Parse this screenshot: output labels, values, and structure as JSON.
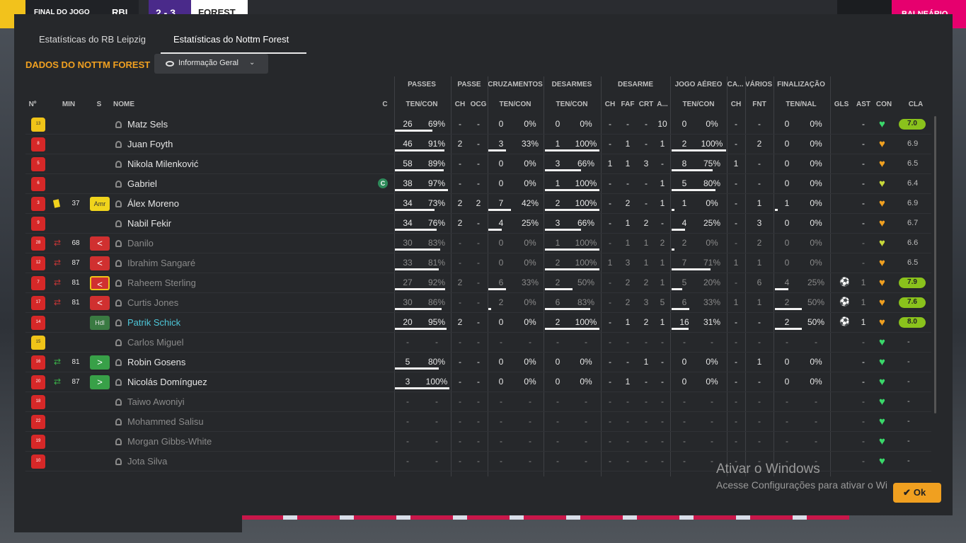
{
  "scoreboard": {
    "result_label": "FINAL DO JOGO",
    "home_short": "RBL",
    "score": "2 - 3",
    "away_short": "FOREST",
    "right_label": "BALNEÁRIO"
  },
  "tabs": [
    {
      "label": "Estatísticas do RB Leipzig",
      "active": false
    },
    {
      "label": "Estatísticas do Nottm Forest",
      "active": true
    }
  ],
  "section_title": "DADOS DO NOTTM FOREST",
  "view_dropdown": {
    "label": "Informação Geral"
  },
  "group_headers": [
    "PASSES",
    "PASSE",
    "CRUZAMENTOS",
    "DESARMES",
    "DESARME",
    "JOGO AÉREO",
    "CA...",
    "VÁRIOS",
    "FINALIZAÇÃO"
  ],
  "column_headers": [
    "Nº",
    "MIN",
    "S",
    "NOME",
    "C",
    "TEN/CON",
    "CH",
    "OCG",
    "TEN/CON",
    "TEN/CON",
    "CH",
    "FAF",
    "CRT",
    "A...",
    "TEN/CON",
    "CH",
    "FNT",
    "TEN/NAL",
    "GLS",
    "AST",
    "CON",
    "CLA"
  ],
  "players": [
    {
      "no": "13",
      "kit": "gk",
      "card": false,
      "sub": "",
      "min": "",
      "pos": "",
      "pos_style": "",
      "name": "Matz Sels",
      "name_style": "",
      "captain": false,
      "dim": false,
      "pass_a": "26",
      "pass_p": "69%",
      "pass_bar": 0.69,
      "ch": "-",
      "ocg": "-",
      "cr_a": "0",
      "cr_p": "0%",
      "cr_bar": 0,
      "des_a": "0",
      "des_p": "0%",
      "des_bar": 0,
      "d_ch": "-",
      "faf": "-",
      "crt": "-",
      "a": "10",
      "air_a": "0",
      "air_p": "0%",
      "air_bar": 0,
      "ca": "-",
      "fnt": "-",
      "fin_a": "0",
      "fin_p": "0%",
      "fin_bar": 0,
      "gls": "",
      "ast": "-",
      "con": "green",
      "cla": "7.0",
      "cla_badge": true
    },
    {
      "no": "8",
      "kit": "",
      "card": false,
      "sub": "",
      "min": "",
      "pos": "",
      "pos_style": "",
      "name": "Juan Foyth",
      "name_style": "",
      "captain": false,
      "dim": false,
      "pass_a": "46",
      "pass_p": "91%",
      "pass_bar": 0.91,
      "ch": "2",
      "ocg": "-",
      "cr_a": "3",
      "cr_p": "33%",
      "cr_bar": 0.33,
      "des_a": "1",
      "des_p": "100%",
      "des_bar": 1,
      "d_ch": "-",
      "faf": "1",
      "crt": "-",
      "a": "1",
      "air_a": "2",
      "air_p": "100%",
      "air_bar": 1,
      "ca": "-",
      "fnt": "2",
      "fin_a": "0",
      "fin_p": "0%",
      "fin_bar": 0,
      "gls": "",
      "ast": "-",
      "con": "orange",
      "cla": "6.9",
      "cla_badge": false
    },
    {
      "no": "5",
      "kit": "",
      "card": false,
      "sub": "",
      "min": "",
      "pos": "",
      "pos_style": "",
      "name": "Nikola Milenković",
      "name_style": "",
      "captain": false,
      "dim": false,
      "pass_a": "58",
      "pass_p": "89%",
      "pass_bar": 0.89,
      "ch": "-",
      "ocg": "-",
      "cr_a": "0",
      "cr_p": "0%",
      "cr_bar": 0,
      "des_a": "3",
      "des_p": "66%",
      "des_bar": 0.66,
      "d_ch": "1",
      "faf": "1",
      "crt": "3",
      "a": "-",
      "air_a": "8",
      "air_p": "75%",
      "air_bar": 0.75,
      "ca": "1",
      "fnt": "-",
      "fin_a": "0",
      "fin_p": "0%",
      "fin_bar": 0,
      "gls": "",
      "ast": "-",
      "con": "orange",
      "cla": "6.5",
      "cla_badge": false
    },
    {
      "no": "6",
      "kit": "",
      "card": false,
      "sub": "",
      "min": "",
      "pos": "",
      "pos_style": "",
      "name": "Gabriel",
      "name_style": "",
      "captain": true,
      "dim": false,
      "pass_a": "38",
      "pass_p": "97%",
      "pass_bar": 0.97,
      "ch": "-",
      "ocg": "-",
      "cr_a": "0",
      "cr_p": "0%",
      "cr_bar": 0,
      "des_a": "1",
      "des_p": "100%",
      "des_bar": 1,
      "d_ch": "-",
      "faf": "-",
      "crt": "-",
      "a": "1",
      "air_a": "5",
      "air_p": "80%",
      "air_bar": 0.8,
      "ca": "-",
      "fnt": "-",
      "fin_a": "0",
      "fin_p": "0%",
      "fin_bar": 0,
      "gls": "",
      "ast": "-",
      "con": "yellow",
      "cla": "6.4",
      "cla_badge": false
    },
    {
      "no": "3",
      "kit": "",
      "card": true,
      "sub": "",
      "min": "37",
      "pos": "Amr",
      "pos_style": "amr",
      "name": "Álex Moreno",
      "name_style": "",
      "captain": false,
      "dim": false,
      "pass_a": "34",
      "pass_p": "73%",
      "pass_bar": 0.73,
      "ch": "2",
      "ocg": "2",
      "cr_a": "7",
      "cr_p": "42%",
      "cr_bar": 0.42,
      "des_a": "2",
      "des_p": "100%",
      "des_bar": 1,
      "d_ch": "-",
      "faf": "2",
      "crt": "-",
      "a": "1",
      "air_a": "1",
      "air_p": "0%",
      "air_bar": 0,
      "ca": "-",
      "fnt": "1",
      "fin_a": "1",
      "fin_p": "0%",
      "fin_bar": 0,
      "gls": "",
      "ast": "-",
      "con": "orange",
      "cla": "6.9",
      "cla_badge": false
    },
    {
      "no": "9",
      "kit": "",
      "card": false,
      "sub": "",
      "min": "",
      "pos": "",
      "pos_style": "",
      "name": "Nabil Fekir",
      "name_style": "",
      "captain": false,
      "dim": false,
      "pass_a": "34",
      "pass_p": "76%",
      "pass_bar": 0.76,
      "ch": "2",
      "ocg": "-",
      "cr_a": "4",
      "cr_p": "25%",
      "cr_bar": 0.25,
      "des_a": "3",
      "des_p": "66%",
      "des_bar": 0.66,
      "d_ch": "-",
      "faf": "1",
      "crt": "2",
      "a": "-",
      "air_a": "4",
      "air_p": "25%",
      "air_bar": 0.25,
      "ca": "-",
      "fnt": "3",
      "fin_a": "0",
      "fin_p": "0%",
      "fin_bar": 0,
      "gls": "",
      "ast": "-",
      "con": "orange",
      "cla": "6.7",
      "cla_badge": false
    },
    {
      "no": "28",
      "kit": "",
      "card": false,
      "sub": "out",
      "min": "68",
      "pos": "<",
      "pos_style": "out",
      "name": "Danilo",
      "name_style": "",
      "captain": false,
      "dim": true,
      "pass_a": "30",
      "pass_p": "83%",
      "pass_bar": 0.83,
      "ch": "-",
      "ocg": "-",
      "cr_a": "0",
      "cr_p": "0%",
      "cr_bar": 0,
      "des_a": "1",
      "des_p": "100%",
      "des_bar": 1,
      "d_ch": "-",
      "faf": "1",
      "crt": "1",
      "a": "2",
      "air_a": "2",
      "air_p": "0%",
      "air_bar": 0,
      "ca": "-",
      "fnt": "2",
      "fin_a": "0",
      "fin_p": "0%",
      "fin_bar": 0,
      "gls": "",
      "ast": "-",
      "con": "yellow",
      "cla": "6.6",
      "cla_badge": false
    },
    {
      "no": "12",
      "kit": "",
      "card": false,
      "sub": "out",
      "min": "87",
      "pos": "<",
      "pos_style": "out",
      "name": "Ibrahim Sangaré",
      "name_style": "",
      "captain": false,
      "dim": true,
      "pass_a": "33",
      "pass_p": "81%",
      "pass_bar": 0.81,
      "ch": "-",
      "ocg": "-",
      "cr_a": "0",
      "cr_p": "0%",
      "cr_bar": 0,
      "des_a": "2",
      "des_p": "100%",
      "des_bar": 1,
      "d_ch": "1",
      "faf": "3",
      "crt": "1",
      "a": "1",
      "air_a": "7",
      "air_p": "71%",
      "air_bar": 0.71,
      "ca": "1",
      "fnt": "1",
      "fin_a": "0",
      "fin_p": "0%",
      "fin_bar": 0,
      "gls": "",
      "ast": "-",
      "con": "orange",
      "cla": "6.5",
      "cla_badge": false
    },
    {
      "no": "7",
      "kit": "",
      "card": false,
      "sub": "out",
      "min": "81",
      "pos": "<",
      "pos_style": "out outlined",
      "name": "Raheem Sterling",
      "name_style": "",
      "captain": false,
      "dim": true,
      "pass_a": "27",
      "pass_p": "92%",
      "pass_bar": 0.92,
      "ch": "2",
      "ocg": "-",
      "cr_a": "6",
      "cr_p": "33%",
      "cr_bar": 0.33,
      "des_a": "2",
      "des_p": "50%",
      "des_bar": 0.5,
      "d_ch": "-",
      "faf": "2",
      "crt": "2",
      "a": "1",
      "air_a": "5",
      "air_p": "20%",
      "air_bar": 0.2,
      "ca": "-",
      "fnt": "6",
      "fin_a": "4",
      "fin_p": "25%",
      "fin_bar": 0.25,
      "gls": "ball",
      "ast": "1",
      "con": "orange",
      "cla": "7.9",
      "cla_badge": true
    },
    {
      "no": "17",
      "kit": "",
      "card": false,
      "sub": "out",
      "min": "81",
      "pos": "<",
      "pos_style": "out",
      "name": "Curtis Jones",
      "name_style": "",
      "captain": false,
      "dim": true,
      "pass_a": "30",
      "pass_p": "86%",
      "pass_bar": 0.86,
      "ch": "-",
      "ocg": "-",
      "cr_a": "2",
      "cr_p": "0%",
      "cr_bar": 0,
      "des_a": "6",
      "des_p": "83%",
      "des_bar": 0.83,
      "d_ch": "-",
      "faf": "2",
      "crt": "3",
      "a": "5",
      "air_a": "6",
      "air_p": "33%",
      "air_bar": 0.33,
      "ca": "1",
      "fnt": "1",
      "fin_a": "2",
      "fin_p": "50%",
      "fin_bar": 0.5,
      "gls": "ball",
      "ast": "1",
      "con": "orange",
      "cla": "7.6",
      "cla_badge": true
    },
    {
      "no": "14",
      "kit": "",
      "card": false,
      "sub": "",
      "min": "",
      "pos": "Hdl",
      "pos_style": "hdl",
      "name": "Patrik Schick",
      "name_style": "highlight",
      "captain": false,
      "dim": false,
      "pass_a": "20",
      "pass_p": "95%",
      "pass_bar": 0.95,
      "ch": "2",
      "ocg": "-",
      "cr_a": "0",
      "cr_p": "0%",
      "cr_bar": 0,
      "des_a": "2",
      "des_p": "100%",
      "des_bar": 1,
      "d_ch": "-",
      "faf": "1",
      "crt": "2",
      "a": "1",
      "air_a": "16",
      "air_p": "31%",
      "air_bar": 0.31,
      "ca": "-",
      "fnt": "-",
      "fin_a": "2",
      "fin_p": "50%",
      "fin_bar": 0.5,
      "gls": "ball",
      "ast": "1",
      "con": "orange",
      "cla": "8.0",
      "cla_badge": true
    },
    {
      "no": "15",
      "kit": "gk",
      "card": false,
      "sub": "",
      "min": "",
      "pos": "",
      "pos_style": "",
      "name": "Carlos Miguel",
      "name_style": "",
      "captain": false,
      "dim": true,
      "pass_a": "-",
      "pass_p": "-",
      "pass_bar": 0,
      "ch": "-",
      "ocg": "-",
      "cr_a": "-",
      "cr_p": "-",
      "cr_bar": 0,
      "des_a": "-",
      "des_p": "-",
      "des_bar": 0,
      "d_ch": "-",
      "faf": "-",
      "crt": "-",
      "a": "-",
      "air_a": "-",
      "air_p": "-",
      "air_bar": 0,
      "ca": "-",
      "fnt": "-",
      "fin_a": "-",
      "fin_p": "-",
      "fin_bar": 0,
      "gls": "",
      "ast": "-",
      "con": "green",
      "cla": "-",
      "cla_badge": false
    },
    {
      "no": "16",
      "kit": "",
      "card": false,
      "sub": "in",
      "min": "81",
      "pos": ">",
      "pos_style": "in",
      "name": "Robin Gosens",
      "name_style": "",
      "captain": false,
      "dim": false,
      "pass_a": "5",
      "pass_p": "80%",
      "pass_bar": 0.8,
      "ch": "-",
      "ocg": "-",
      "cr_a": "0",
      "cr_p": "0%",
      "cr_bar": 0,
      "des_a": "0",
      "des_p": "0%",
      "des_bar": 0,
      "d_ch": "-",
      "faf": "-",
      "crt": "1",
      "a": "-",
      "air_a": "0",
      "air_p": "0%",
      "air_bar": 0,
      "ca": "-",
      "fnt": "1",
      "fin_a": "0",
      "fin_p": "0%",
      "fin_bar": 0,
      "gls": "",
      "ast": "-",
      "con": "green",
      "cla": "-",
      "cla_badge": false
    },
    {
      "no": "20",
      "kit": "",
      "card": false,
      "sub": "in",
      "min": "87",
      "pos": ">",
      "pos_style": "in",
      "name": "Nicolás Domínguez",
      "name_style": "",
      "captain": false,
      "dim": false,
      "pass_a": "3",
      "pass_p": "100%",
      "pass_bar": 1,
      "ch": "-",
      "ocg": "-",
      "cr_a": "0",
      "cr_p": "0%",
      "cr_bar": 0,
      "des_a": "0",
      "des_p": "0%",
      "des_bar": 0,
      "d_ch": "-",
      "faf": "1",
      "crt": "-",
      "a": "-",
      "air_a": "0",
      "air_p": "0%",
      "air_bar": 0,
      "ca": "-",
      "fnt": "-",
      "fin_a": "0",
      "fin_p": "0%",
      "fin_bar": 0,
      "gls": "",
      "ast": "-",
      "con": "green",
      "cla": "-",
      "cla_badge": false
    },
    {
      "no": "18",
      "kit": "",
      "card": false,
      "sub": "",
      "min": "",
      "pos": "",
      "pos_style": "",
      "name": "Taiwo Awoniyi",
      "name_style": "",
      "captain": false,
      "dim": true,
      "pass_a": "-",
      "pass_p": "-",
      "pass_bar": 0,
      "ch": "-",
      "ocg": "-",
      "cr_a": "-",
      "cr_p": "-",
      "cr_bar": 0,
      "des_a": "-",
      "des_p": "-",
      "des_bar": 0,
      "d_ch": "-",
      "faf": "-",
      "crt": "-",
      "a": "-",
      "air_a": "-",
      "air_p": "-",
      "air_bar": 0,
      "ca": "-",
      "fnt": "-",
      "fin_a": "-",
      "fin_p": "-",
      "fin_bar": 0,
      "gls": "",
      "ast": "-",
      "con": "green",
      "cla": "-",
      "cla_badge": false
    },
    {
      "no": "22",
      "kit": "",
      "card": false,
      "sub": "",
      "min": "",
      "pos": "",
      "pos_style": "",
      "name": "Mohammed Salisu",
      "name_style": "",
      "captain": false,
      "dim": true,
      "pass_a": "-",
      "pass_p": "-",
      "pass_bar": 0,
      "ch": "-",
      "ocg": "-",
      "cr_a": "-",
      "cr_p": "-",
      "cr_bar": 0,
      "des_a": "-",
      "des_p": "-",
      "des_bar": 0,
      "d_ch": "-",
      "faf": "-",
      "crt": "-",
      "a": "-",
      "air_a": "-",
      "air_p": "-",
      "air_bar": 0,
      "ca": "-",
      "fnt": "-",
      "fin_a": "-",
      "fin_p": "-",
      "fin_bar": 0,
      "gls": "",
      "ast": "-",
      "con": "green",
      "cla": "-",
      "cla_badge": false
    },
    {
      "no": "19",
      "kit": "",
      "card": false,
      "sub": "",
      "min": "",
      "pos": "",
      "pos_style": "",
      "name": "Morgan Gibbs-White",
      "name_style": "",
      "captain": false,
      "dim": true,
      "pass_a": "-",
      "pass_p": "-",
      "pass_bar": 0,
      "ch": "-",
      "ocg": "-",
      "cr_a": "-",
      "cr_p": "-",
      "cr_bar": 0,
      "des_a": "-",
      "des_p": "-",
      "des_bar": 0,
      "d_ch": "-",
      "faf": "-",
      "crt": "-",
      "a": "-",
      "air_a": "-",
      "air_p": "-",
      "air_bar": 0,
      "ca": "-",
      "fnt": "-",
      "fin_a": "-",
      "fin_p": "-",
      "fin_bar": 0,
      "gls": "",
      "ast": "-",
      "con": "green",
      "cla": "-",
      "cla_badge": false
    },
    {
      "no": "10",
      "kit": "",
      "card": false,
      "sub": "",
      "min": "",
      "pos": "",
      "pos_style": "",
      "name": "Jota Silva",
      "name_style": "",
      "captain": false,
      "dim": true,
      "pass_a": "-",
      "pass_p": "-",
      "pass_bar": 0,
      "ch": "-",
      "ocg": "-",
      "cr_a": "-",
      "cr_p": "-",
      "cr_bar": 0,
      "des_a": "-",
      "des_p": "-",
      "des_bar": 0,
      "d_ch": "-",
      "faf": "-",
      "crt": "-",
      "a": "-",
      "air_a": "-",
      "air_p": "-",
      "air_bar": 0,
      "ca": "-",
      "fnt": "-",
      "fin_a": "-",
      "fin_p": "-",
      "fin_bar": 0,
      "gls": "",
      "ast": "-",
      "con": "green",
      "cla": "-",
      "cla_badge": false
    }
  ],
  "colors": {
    "accent": "#f0a020",
    "highlight_name": "#4ec6d8",
    "con_green": "#3ad86a",
    "con_orange": "#f0a020",
    "con_yellow": "#c8d83a",
    "rating_badge": "#8ac21c"
  },
  "icons": {
    "captain": "captain-c-icon",
    "goal": "football-icon",
    "sub_out": "substitution-out-icon",
    "sub_in": "substitution-in-icon",
    "condition": "heart-icon"
  },
  "watermark": {
    "line1": "Ativar o Windows",
    "line2": "Acesse Configurações para ativar o Wi"
  },
  "ok_button": {
    "label": "Ok"
  }
}
